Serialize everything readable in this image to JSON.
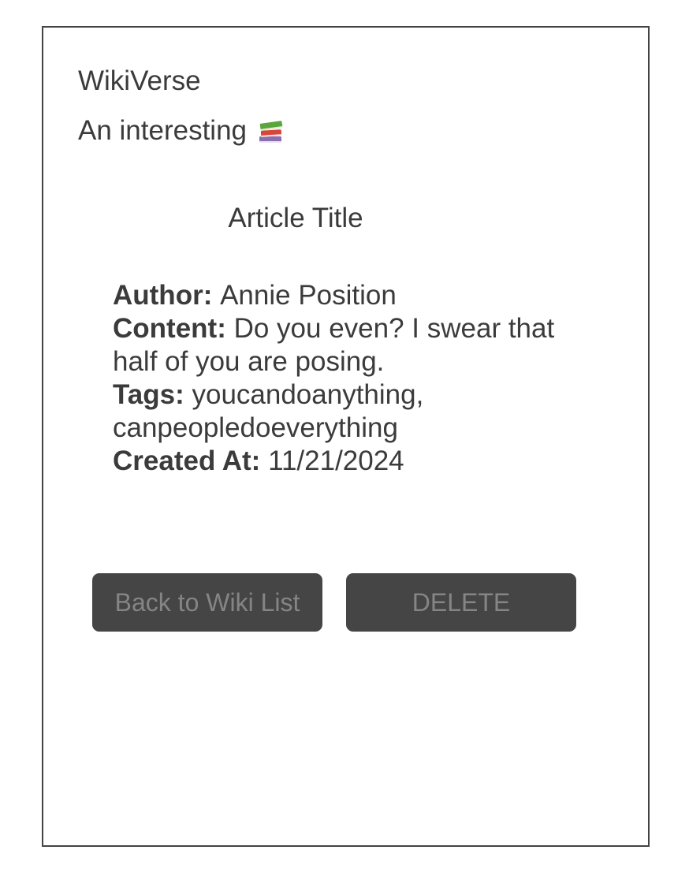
{
  "header": {
    "site_title": "WikiVerse",
    "tagline": "An interesting",
    "tagline_icon": "books-icon"
  },
  "article": {
    "title": "Article Title",
    "author_label": "Author:",
    "author": "Annie Position",
    "content_label": "Content:",
    "content": "Do you even? I swear that half of you are posing.",
    "tags_label": "Tags:",
    "tags": "youcandoanything, canpeopledoeverything",
    "created_label": "Created At:",
    "created_at": "11/21/2024"
  },
  "actions": {
    "back_label": "Back to Wiki List",
    "delete_label": "DELETE"
  },
  "colors": {
    "border": "#444444",
    "text": "#3b3b3b",
    "button_bg": "#454545",
    "button_text": "#858585"
  }
}
